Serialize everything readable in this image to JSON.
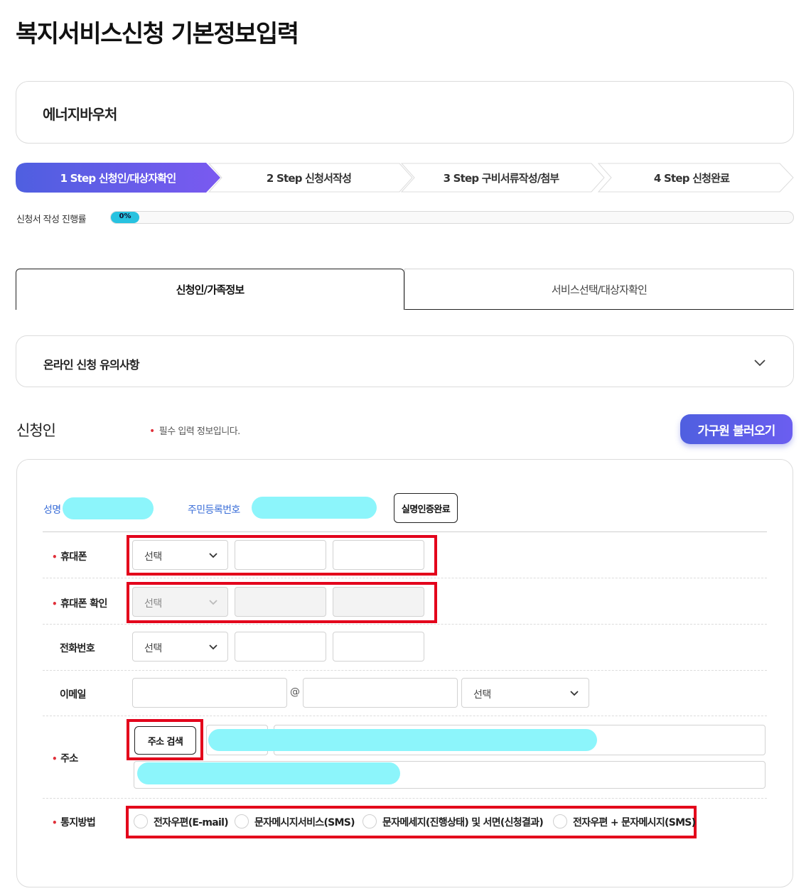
{
  "page": {
    "title": "복지서비스신청 기본정보입력"
  },
  "service": {
    "name": "에너지바우처"
  },
  "steps": [
    {
      "label": "1 Step 신청인/대상자확인",
      "active": true
    },
    {
      "label": "2 Step 신청서작성",
      "active": false
    },
    {
      "label": "3 Step 구비서류작성/첨부",
      "active": false
    },
    {
      "label": "4 Step 신청완료",
      "active": false
    }
  ],
  "progress": {
    "label": "신청서 작성 진행률",
    "value": 0,
    "text": "0%"
  },
  "tabs": [
    {
      "label": "신청인/가족정보",
      "active": true
    },
    {
      "label": "서비스선택/대상자확인",
      "active": false
    }
  ],
  "notice": {
    "label": "온라인 신청 유의사항"
  },
  "applicant": {
    "section_title": "신청인",
    "required_note": "필수 입력 정보입니다.",
    "family_button": "가구원 불러오기",
    "name_label": "성명",
    "rrn_label": "주민등록번호",
    "verify_button": "실명인증완료",
    "mobile_label": "휴대폰",
    "mobile_confirm_label": "휴대폰 확인",
    "phone_label": "전화번호",
    "email_label": "이메일",
    "email_at": "@",
    "address_label": "주소",
    "address_search_button": "주소 검색",
    "notify_label": "통지방법",
    "select_placeholder": "선택",
    "notify_options": [
      "전자우편(E-mail)",
      "문자메시지서비스(SMS)",
      "문자메세지(진행상태) 및 서면(신청결과)",
      "전자우편 + 문자메시지(SMS)"
    ]
  },
  "colors": {
    "accent_gradient_start": "#4f5fe0",
    "accent_gradient_end": "#6b5ef0",
    "progress": "#27c2e0",
    "required": "#e0303a",
    "highlight_frame": "#e3001b",
    "mask": "#8cf5fb"
  }
}
